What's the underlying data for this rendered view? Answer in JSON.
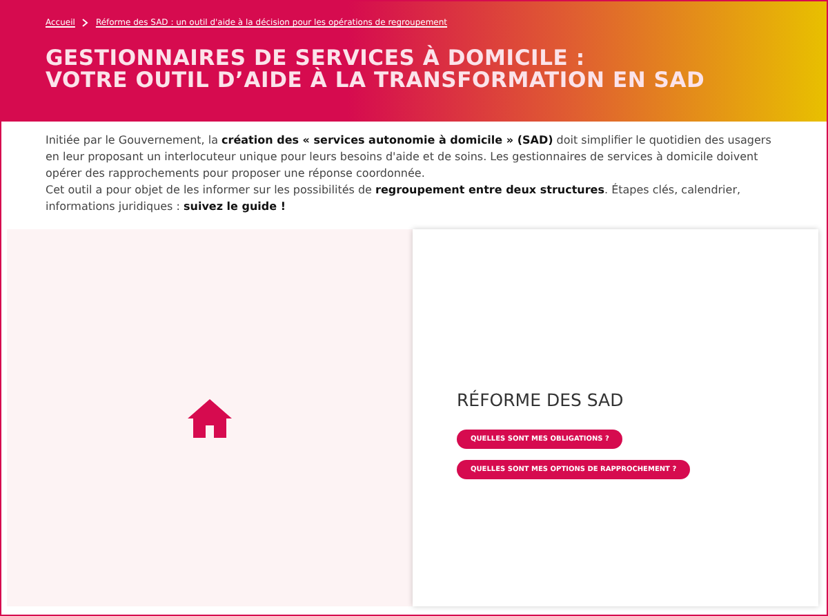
{
  "breadcrumb": [
    {
      "label": "Accueil"
    },
    {
      "label": "Réforme des SAD : un outil d'aide à la décision pour les opérations de regroupement"
    }
  ],
  "title_lines": [
    "GESTIONNAIRES DE SERVICES À DOMICILE :",
    "VOTRE OUTIL D’AIDE À LA TRANSFORMATION EN SAD"
  ],
  "intro": [
    "Initiée par le Gouvernement, la **création des « services autonomie à domicile » (SAD)** doit simplifier le quotidien des usagers en leur proposant un interlocuteur unique pour leurs besoins d'aide et de soins. Les gestionnaires de services à domicile doivent opérer des rapprochements pour proposer une réponse coordonnée.",
    "Cet outil a pour objet de les informer sur les possibilités de **regroupement entre deux structures**. Étapes clés, calendrier, informations juridiques : **suivez le guide !**"
  ],
  "card": {
    "heading": "RÉFORME DES SAD",
    "buttons": [
      "QUELLES SONT MES OBLIGATIONS ?",
      "QUELLES SONT MES OPTIONS DE RAPPROCHEMENT ?"
    ]
  }
}
